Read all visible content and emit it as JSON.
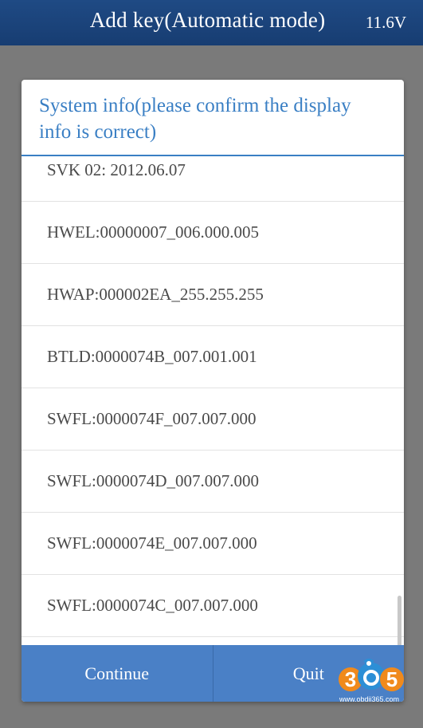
{
  "header": {
    "title": "Add key(Automatic mode)",
    "voltage": "11.6V"
  },
  "dialog": {
    "title": "System info(please confirm the display info is correct)",
    "items": [
      "SVK 02: 2012.06.07",
      "HWEL:00000007_006.000.005",
      "HWAP:000002EA_255.255.255",
      "BTLD:0000074B_007.001.001",
      "SWFL:0000074F_007.007.000",
      "SWFL:0000074D_007.007.000",
      "SWFL:0000074E_007.007.000",
      "SWFL:0000074C_007.007.000"
    ],
    "buttons": {
      "continue": "Continue",
      "quit": "Quit"
    }
  },
  "watermark": {
    "logo_text": "305",
    "url": "www.obdii365.com"
  },
  "colors": {
    "titlebar": "#1f4a84",
    "accent": "#3a7fc4",
    "button_bar": "#4a80c6",
    "backdrop": "#7a7a7a"
  }
}
